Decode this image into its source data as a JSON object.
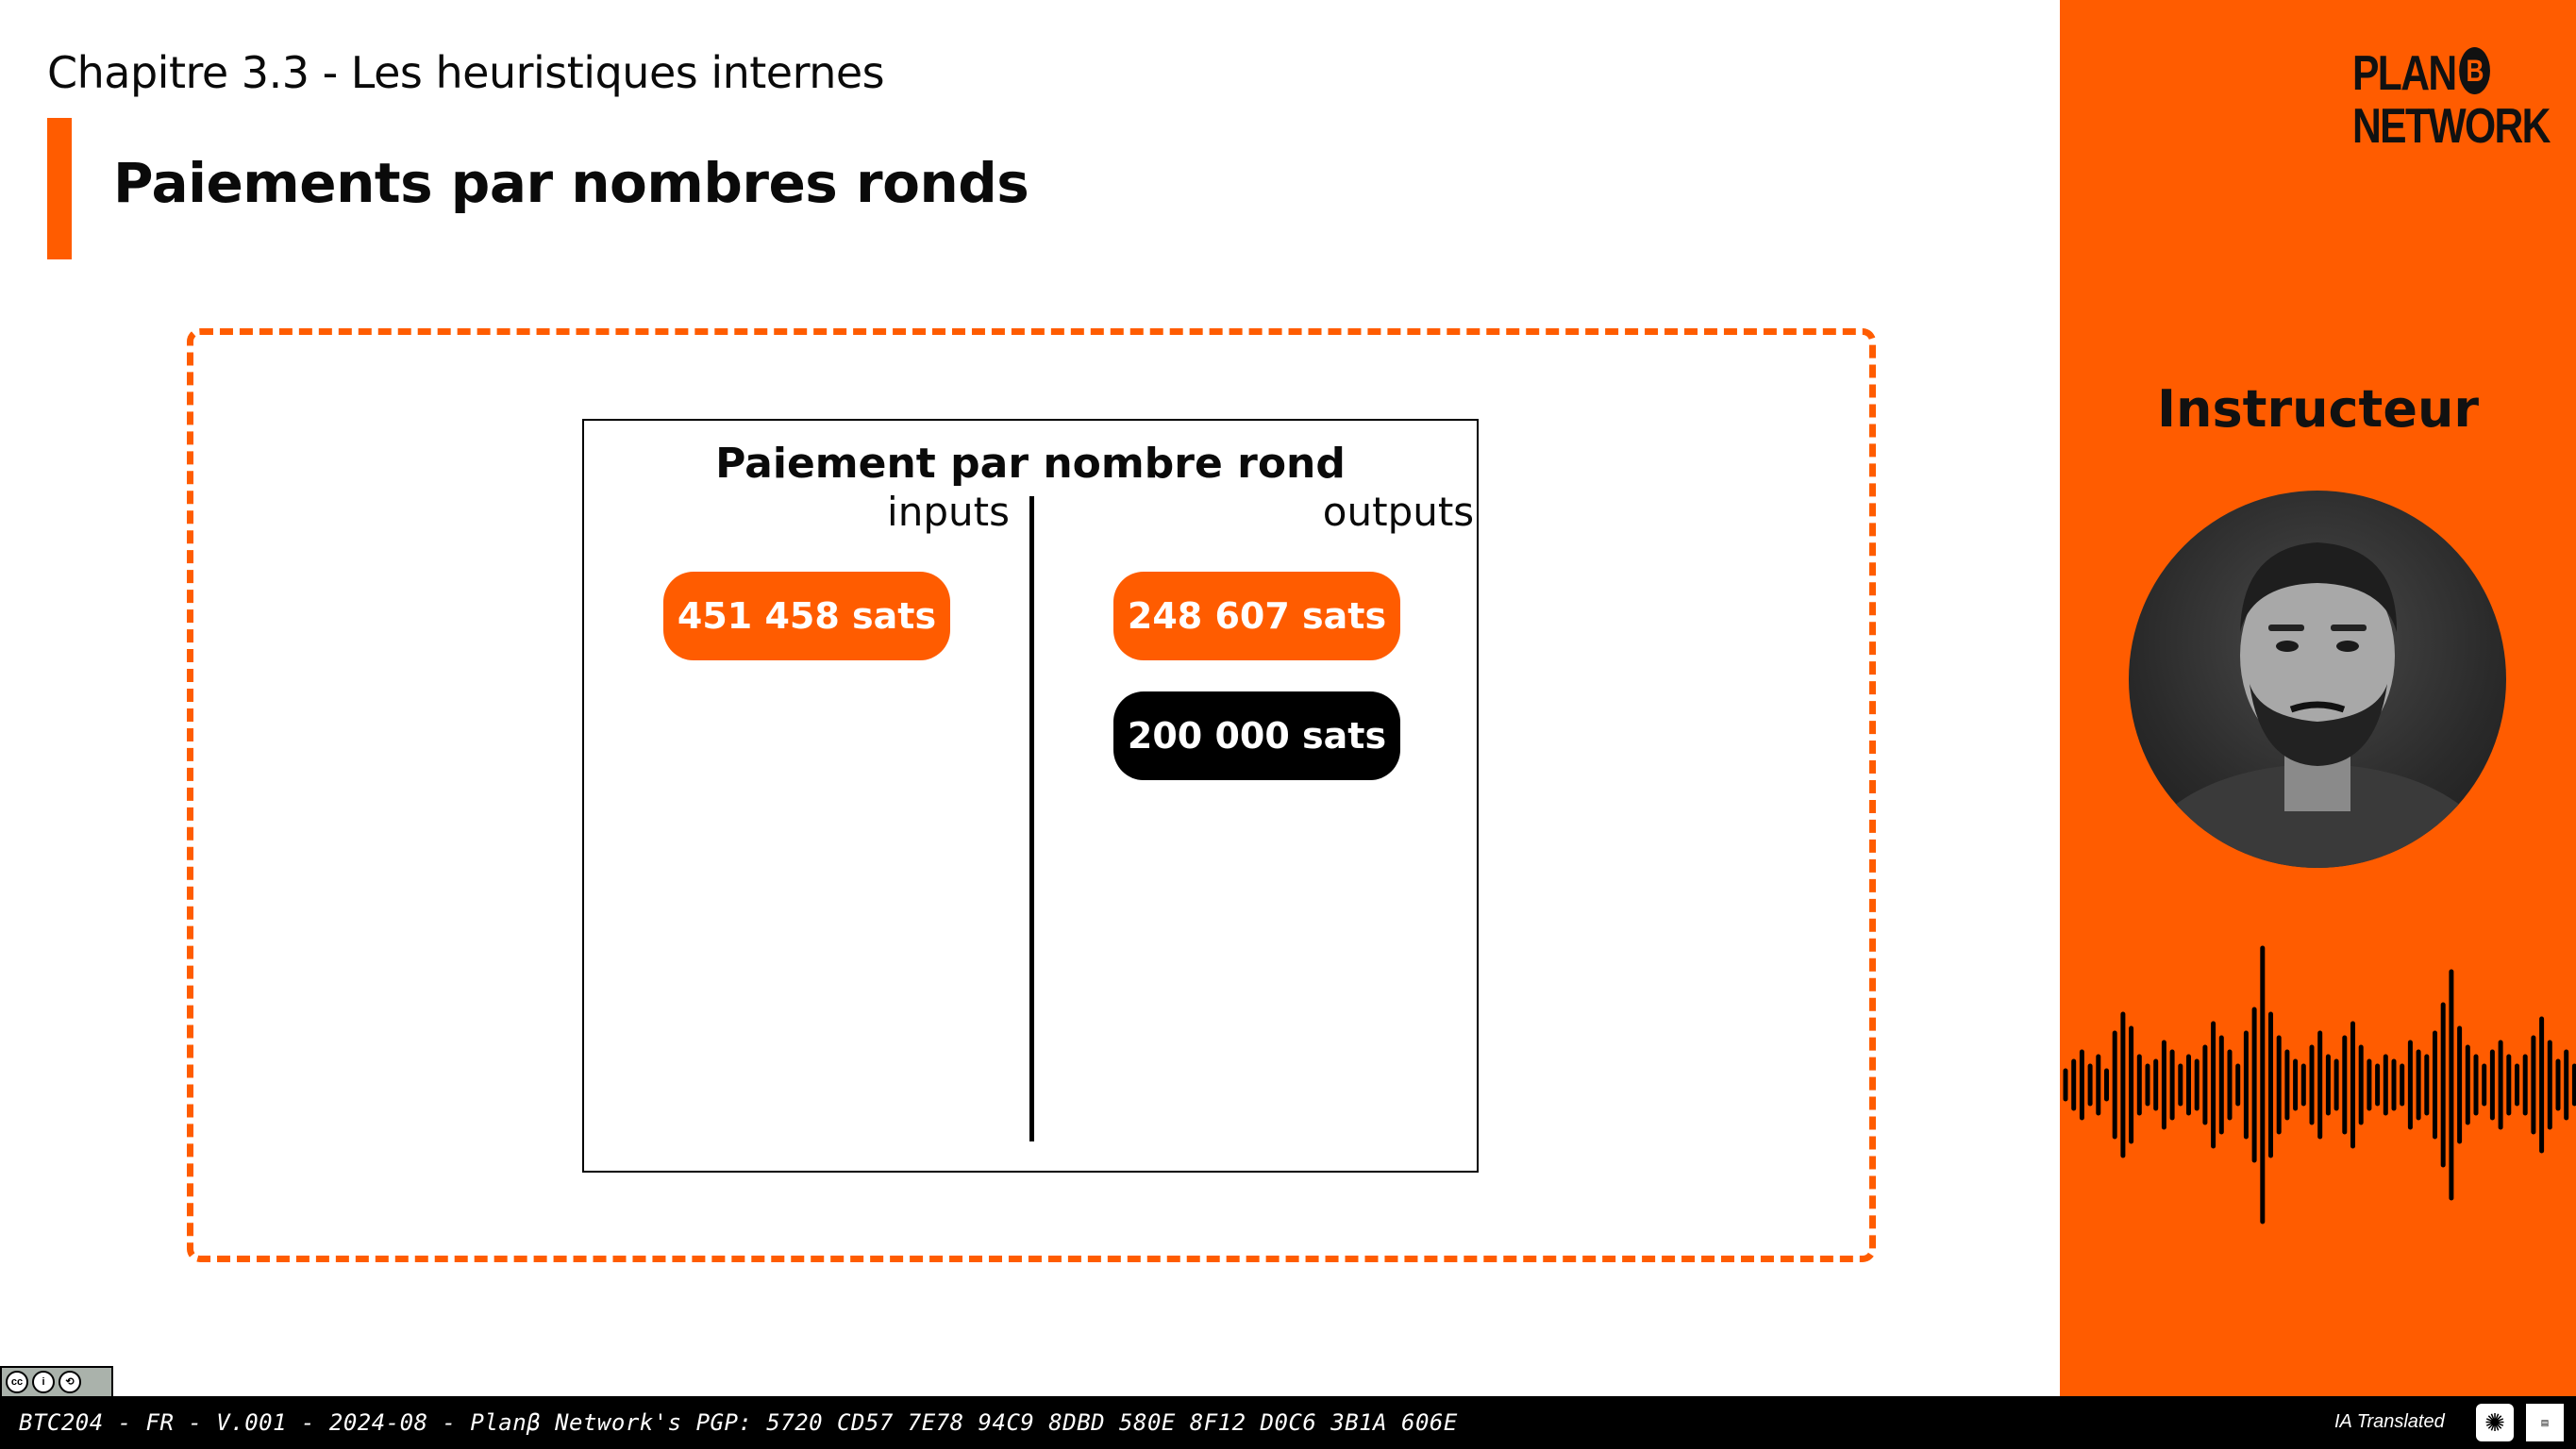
{
  "header": {
    "chapter": "Chapitre 3.3 - Les heuristiques internes",
    "title": "Paiements par nombres ronds"
  },
  "diagram": {
    "title": "Paiement par nombre rond",
    "inputs_label": "inputs",
    "outputs_label": "outputs",
    "inputs": [
      "451 458 sats"
    ],
    "outputs": [
      "248 607 sats",
      "200 000 sats"
    ]
  },
  "sidebar": {
    "logo_line1": "PLAN",
    "logo_b": "B",
    "logo_line2": "NETWORK",
    "instructor_label": "Instructeur"
  },
  "footer": {
    "text": "BTC204 - FR - V.001 - 2024-08 - Planβ Network's PGP: 5720 CD57 7E78 94C9 8DBD 580E 8F12 D0C6 3B1A 606E",
    "ia_translated": "IA Translated"
  },
  "colors": {
    "accent": "#FF5C00",
    "black": "#000000"
  },
  "icons": [
    "cc-license-icon",
    "openai-icon",
    "lab-logo-icon",
    "instructor-avatar"
  ]
}
